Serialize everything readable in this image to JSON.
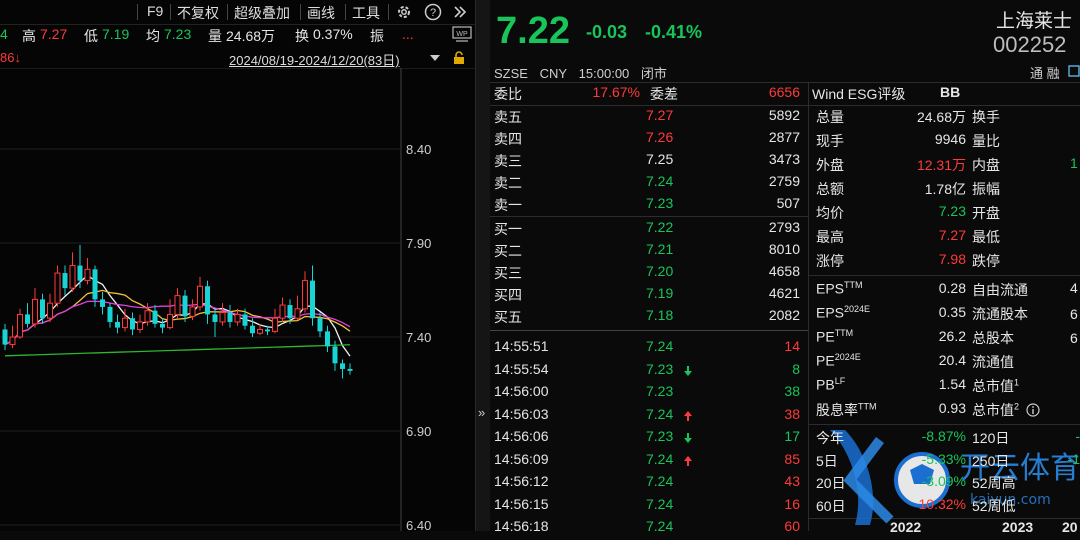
{
  "toolbar": {
    "items": [
      "F9",
      "不复权",
      "超级叠加",
      "画线",
      "工具"
    ],
    "icons": [
      "gear-icon",
      "help-icon",
      "double-chevron-right-icon"
    ]
  },
  "quote_bar": {
    "left_fragment": "4",
    "high_label": "高",
    "high_value": "7.27",
    "low_label": "低",
    "low_value": "7.19",
    "avg_label": "均",
    "avg_value": "7.23",
    "vol_label": "量",
    "vol_value": "24.68万",
    "turn_label": "换",
    "turn_value": "0.37%",
    "amp_label": "振",
    "more": "..."
  },
  "range_bar": {
    "left_fragment": "86↓",
    "date_range": "2024/08/19-2024/12/20(83日)"
  },
  "chart_data": {
    "type": "candlestick",
    "y_ticks": [
      "8.40",
      "7.90",
      "7.40",
      "6.90",
      "6.40"
    ],
    "ylim": [
      6.4,
      8.5
    ],
    "colors": {
      "up": "#ff3a3a",
      "down": "#19d4d4",
      "ma5": "#f0f0f0",
      "ma10": "#f0c23a",
      "ma20": "#e040e0",
      "ma60": "#2fb52f"
    },
    "candles": [
      [
        7.44,
        7.36,
        7.47,
        7.33
      ],
      [
        7.36,
        7.4,
        7.46,
        7.34
      ],
      [
        7.4,
        7.52,
        7.55,
        7.39
      ],
      [
        7.52,
        7.47,
        7.58,
        7.45
      ],
      [
        7.47,
        7.6,
        7.66,
        7.45
      ],
      [
        7.6,
        7.5,
        7.63,
        7.47
      ],
      [
        7.5,
        7.58,
        7.63,
        7.48
      ],
      [
        7.58,
        7.74,
        7.78,
        7.56
      ],
      [
        7.74,
        7.66,
        7.78,
        7.62
      ],
      [
        7.66,
        7.78,
        7.85,
        7.64
      ],
      [
        7.78,
        7.7,
        7.89,
        7.66
      ],
      [
        7.7,
        7.76,
        7.82,
        7.68
      ],
      [
        7.76,
        7.6,
        7.78,
        7.56
      ],
      [
        7.6,
        7.56,
        7.64,
        7.52
      ],
      [
        7.56,
        7.48,
        7.58,
        7.45
      ],
      [
        7.48,
        7.45,
        7.52,
        7.42
      ],
      [
        7.45,
        7.5,
        7.55,
        7.43
      ],
      [
        7.5,
        7.44,
        7.53,
        7.41
      ],
      [
        7.44,
        7.48,
        7.52,
        7.42
      ],
      [
        7.48,
        7.54,
        7.58,
        7.46
      ],
      [
        7.54,
        7.47,
        7.57,
        7.45
      ],
      [
        7.47,
        7.45,
        7.5,
        7.42
      ],
      [
        7.45,
        7.52,
        7.6,
        7.44
      ],
      [
        7.52,
        7.62,
        7.66,
        7.5
      ],
      [
        7.62,
        7.51,
        7.65,
        7.48
      ],
      [
        7.51,
        7.56,
        7.6,
        7.49
      ],
      [
        7.56,
        7.67,
        7.72,
        7.54
      ],
      [
        7.67,
        7.52,
        7.7,
        7.47
      ],
      [
        7.52,
        7.48,
        7.55,
        7.4
      ],
      [
        7.48,
        7.53,
        7.58,
        7.46
      ],
      [
        7.53,
        7.48,
        7.57,
        7.45
      ],
      [
        7.48,
        7.52,
        7.55,
        7.46
      ],
      [
        7.52,
        7.46,
        7.55,
        7.44
      ],
      [
        7.46,
        7.42,
        7.5,
        7.4
      ],
      [
        7.42,
        7.44,
        7.47,
        7.41
      ],
      [
        7.44,
        7.43,
        7.46,
        7.41
      ],
      [
        7.43,
        7.5,
        7.55,
        7.42
      ],
      [
        7.5,
        7.57,
        7.61,
        7.48
      ],
      [
        7.57,
        7.5,
        7.6,
        7.47
      ],
      [
        7.5,
        7.55,
        7.62,
        7.49
      ],
      [
        7.55,
        7.7,
        7.75,
        7.53
      ],
      [
        7.7,
        7.5,
        7.78,
        7.46
      ],
      [
        7.5,
        7.43,
        7.53,
        7.4
      ],
      [
        7.43,
        7.35,
        7.46,
        7.32
      ],
      [
        7.35,
        7.26,
        7.38,
        7.22
      ],
      [
        7.26,
        7.23,
        7.28,
        7.18
      ],
      [
        7.23,
        7.22,
        7.26,
        7.2
      ]
    ]
  },
  "summary": {
    "price": "7.22",
    "change": "-0.03",
    "change_pct": "-0.41%",
    "name": "上海莱士",
    "code": "002252",
    "market": "SZSE",
    "currency": "CNY",
    "time": "15:00:00",
    "status": "闭市",
    "tong": "通",
    "rong": "融"
  },
  "order_book": {
    "wei_bi_label": "委比",
    "wei_bi_value": "17.67%",
    "wei_cha_label": "委差",
    "wei_cha_value": "6656",
    "asks": [
      {
        "label": "卖五",
        "price": "7.27",
        "vol": "5892",
        "color": "r"
      },
      {
        "label": "卖四",
        "price": "7.26",
        "vol": "2877",
        "color": "r"
      },
      {
        "label": "卖三",
        "price": "7.25",
        "vol": "3473",
        "color": "w"
      },
      {
        "label": "卖二",
        "price": "7.24",
        "vol": "2759",
        "color": "g"
      },
      {
        "label": "卖一",
        "price": "7.23",
        "vol": "507",
        "color": "g"
      }
    ],
    "bids": [
      {
        "label": "买一",
        "price": "7.22",
        "vol": "2793",
        "color": "g"
      },
      {
        "label": "买二",
        "price": "7.21",
        "vol": "8010",
        "color": "g"
      },
      {
        "label": "买三",
        "price": "7.20",
        "vol": "4658",
        "color": "g"
      },
      {
        "label": "买四",
        "price": "7.19",
        "vol": "4621",
        "color": "g"
      },
      {
        "label": "买五",
        "price": "7.18",
        "vol": "2082",
        "color": "g"
      }
    ]
  },
  "ticks": [
    {
      "time": "14:55:51",
      "price": "7.24",
      "arrow": "",
      "vol": "14",
      "vc": "r"
    },
    {
      "time": "14:55:54",
      "price": "7.23",
      "arrow": "down",
      "vol": "8",
      "vc": "g"
    },
    {
      "time": "14:56:00",
      "price": "7.23",
      "arrow": "",
      "vol": "38",
      "vc": "g"
    },
    {
      "time": "14:56:03",
      "price": "7.24",
      "arrow": "up",
      "vol": "38",
      "vc": "r"
    },
    {
      "time": "14:56:06",
      "price": "7.23",
      "arrow": "down",
      "vol": "17",
      "vc": "g"
    },
    {
      "time": "14:56:09",
      "price": "7.24",
      "arrow": "up",
      "vol": "85",
      "vc": "r"
    },
    {
      "time": "14:56:12",
      "price": "7.24",
      "arrow": "",
      "vol": "43",
      "vc": "r"
    },
    {
      "time": "14:56:15",
      "price": "7.24",
      "arrow": "",
      "vol": "16",
      "vc": "r"
    },
    {
      "time": "14:56:18",
      "price": "7.24",
      "arrow": "",
      "vol": "60",
      "vc": "r"
    }
  ],
  "esg": {
    "label": "Wind ESG评级",
    "value": "BB"
  },
  "stats": [
    {
      "label": "总量",
      "value": "24.68万",
      "vc": "w",
      "label2": "换手"
    },
    {
      "label": "现手",
      "value": "9946",
      "vc": "w",
      "label2": "量比"
    },
    {
      "label": "外盘",
      "value": "12.31万",
      "vc": "r",
      "label2": "内盘"
    },
    {
      "label": "总额",
      "value": "1.78亿",
      "vc": "w",
      "label2": "振幅"
    },
    {
      "label": "均价",
      "value": "7.23",
      "vc": "g",
      "label2": "开盘"
    },
    {
      "label": "最高",
      "value": "7.27",
      "vc": "r",
      "label2": "最低"
    },
    {
      "label": "涨停",
      "value": "7.98",
      "vc": "r",
      "label2": "跌停"
    }
  ],
  "fundamentals": [
    {
      "label": "EPS",
      "sup": "TTM",
      "value": "0.28",
      "label2": "自由流通",
      "sup2": ""
    },
    {
      "label": "EPS",
      "sup": "2024E",
      "value": "0.35",
      "label2": "流通股本",
      "sup2": ""
    },
    {
      "label": "PE",
      "sup": "TTM",
      "value": "26.2",
      "label2": "总股本",
      "sup2": ""
    },
    {
      "label": "PE",
      "sup": "2024E",
      "value": "20.4",
      "label2": "流通值",
      "sup2": ""
    },
    {
      "label": "PB",
      "sup": "LF",
      "value": "1.54",
      "label2": "总市值",
      "sup2": "1"
    },
    {
      "label": "股息率",
      "sup": "TTM",
      "value": "0.93",
      "label2": "总市值",
      "sup2": "2"
    }
  ],
  "right_edge_fragments": [
    "1",
    "4",
    "6",
    "6"
  ],
  "perf": [
    {
      "label": "今年",
      "value": "-8.87%",
      "vc": "g",
      "label2": "120日",
      "v2": "-"
    },
    {
      "label": "5日",
      "value": "-5.33%",
      "vc": "g",
      "label2": "250日",
      "v2": "-1"
    },
    {
      "label": "20日",
      "value": "-3.09%",
      "vc": "g",
      "label2": "52周高",
      "v2": ""
    },
    {
      "label": "60日",
      "value": "10.32%",
      "vc": "r",
      "label2": "52周低",
      "v2": ""
    }
  ],
  "years": [
    "2022",
    "2023",
    "20"
  ],
  "watermark": {
    "text": "开云体育",
    "sub": "kaiyun.com"
  }
}
